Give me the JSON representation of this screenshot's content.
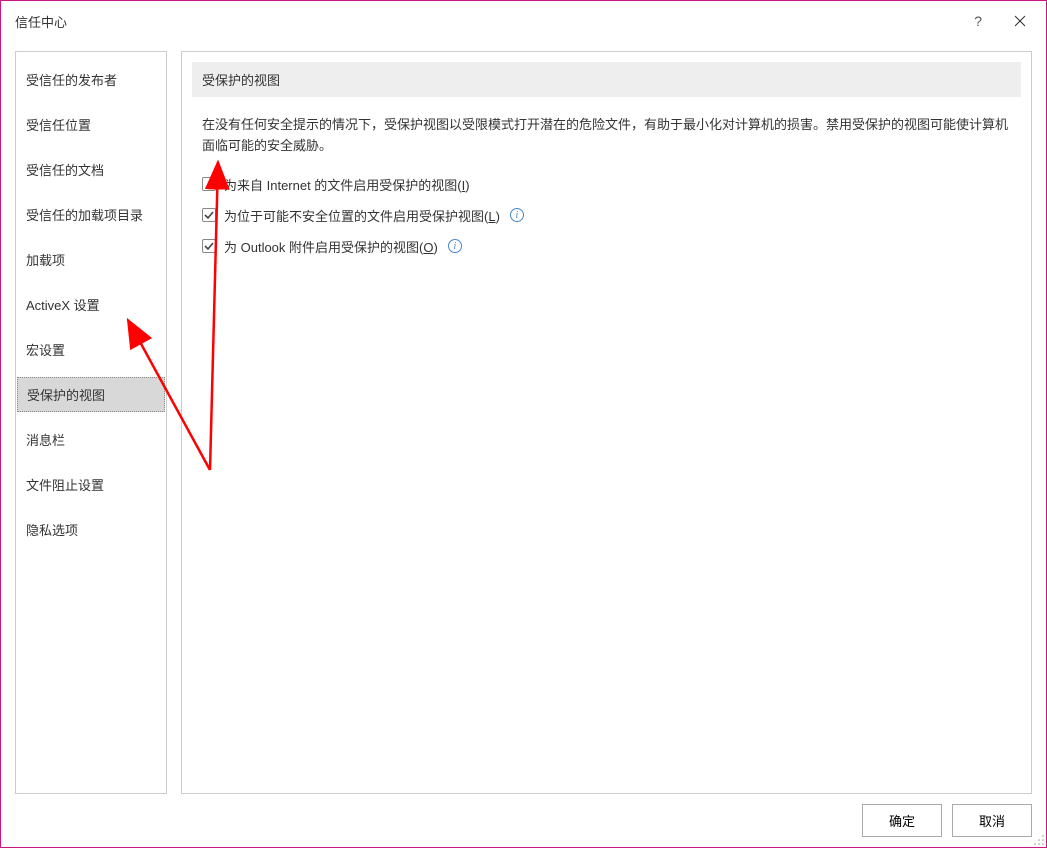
{
  "dialog": {
    "title": "信任中心"
  },
  "sidebar": {
    "items": [
      {
        "label": "受信任的发布者",
        "selected": false
      },
      {
        "label": "受信任位置",
        "selected": false
      },
      {
        "label": "受信任的文档",
        "selected": false
      },
      {
        "label": "受信任的加载项目录",
        "selected": false
      },
      {
        "label": "加载项",
        "selected": false
      },
      {
        "label": "ActiveX 设置",
        "selected": false
      },
      {
        "label": "宏设置",
        "selected": false
      },
      {
        "label": "受保护的视图",
        "selected": true
      },
      {
        "label": "消息栏",
        "selected": false
      },
      {
        "label": "文件阻止设置",
        "selected": false
      },
      {
        "label": "隐私选项",
        "selected": false
      }
    ]
  },
  "main": {
    "section_title": "受保护的视图",
    "description": "在没有任何安全提示的情况下，受保护视图以受限模式打开潜在的危险文件，有助于最小化对计算机的损害。禁用受保护的视图可能使计算机面临可能的安全威胁。",
    "checkboxes": [
      {
        "label_pre": "为来自 Internet 的文件启用受保护的视图(",
        "accel": "I",
        "label_post": ")",
        "checked": false,
        "info": false
      },
      {
        "label_pre": "为位于可能不安全位置的文件启用受保护视图(",
        "accel": "L",
        "label_post": ")",
        "checked": true,
        "info": true
      },
      {
        "label_pre": "为 Outlook 附件启用受保护的视图(",
        "accel": "O",
        "label_post": ")",
        "checked": true,
        "info": true
      }
    ]
  },
  "buttons": {
    "ok": "确定",
    "cancel": "取消"
  }
}
